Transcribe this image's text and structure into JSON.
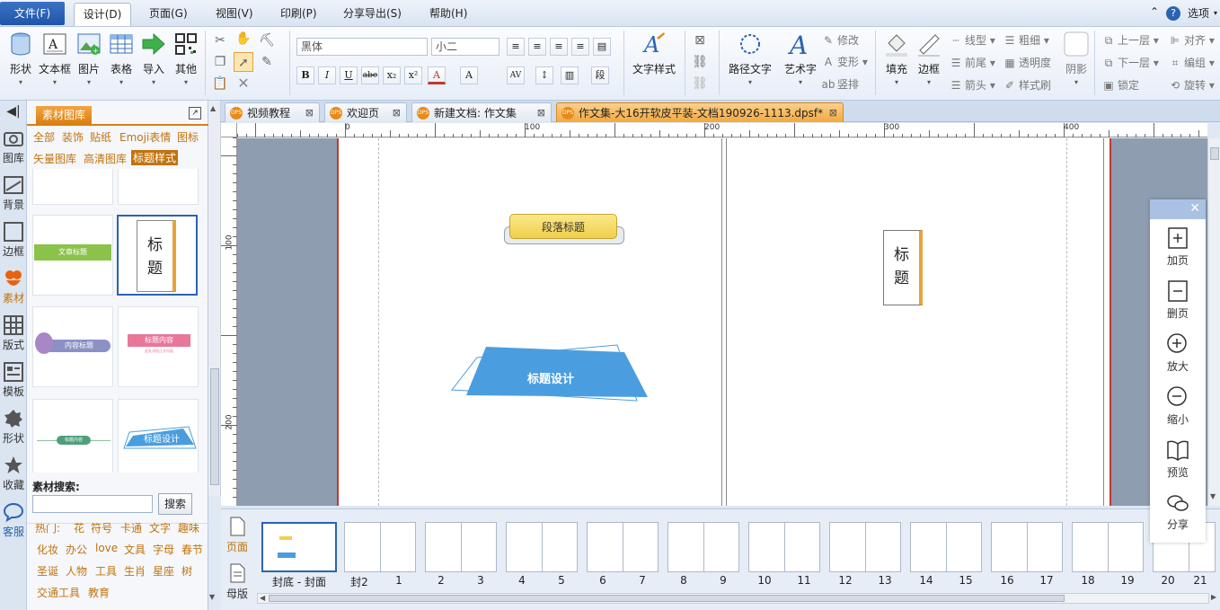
{
  "menu": {
    "file": "文件(F)",
    "items": [
      "设计(D)",
      "页面(G)",
      "视图(V)",
      "印刷(P)",
      "分享导出(S)",
      "帮助(H)"
    ],
    "options": "选项"
  },
  "ribbon": {
    "insert": [
      "形状",
      "文本框",
      "图片",
      "表格",
      "导入",
      "其他"
    ],
    "font_name": "黑体",
    "font_size": "小二",
    "format": [
      "B",
      "I",
      "U",
      "abe",
      "x₂",
      "x²"
    ],
    "text_style": "文字样式",
    "path_text": "路径文字",
    "art_text": "艺术字",
    "art_edit": [
      "修改",
      "变形",
      "竖排"
    ],
    "fill": "填充",
    "border": "边框",
    "line": [
      "线型",
      "前尾",
      "箭头"
    ],
    "thick": [
      "粗细",
      "透明度",
      "样式刷"
    ],
    "shadow": "阴影",
    "layer": [
      "上一层",
      "下一层",
      "锁定"
    ],
    "arrange": [
      "对齐",
      "编组",
      "旋转"
    ],
    "para_btn": "段"
  },
  "rail": [
    "图库",
    "背景",
    "边框",
    "素材",
    "版式",
    "模板",
    "形状",
    "收藏",
    "客服"
  ],
  "panel": {
    "title": "素材图库",
    "cats_row1": [
      "全部",
      "装饰",
      "贴纸",
      "Emoji表情",
      "图标"
    ],
    "cats_row2": [
      "矢量图库",
      "高清图库",
      "标题样式"
    ],
    "thumbs": {
      "article": "文章标题",
      "biaoti": [
        "标",
        "题"
      ],
      "content_title": "内容标题",
      "title_content": "标题内容",
      "title_content_sub": "此处添加正文内容",
      "content_tag": "标题内容",
      "design": "标题设计"
    },
    "search_label": "素材搜索:",
    "search_button": "搜索",
    "hot_label": "热门:",
    "hot_tags": [
      "花",
      "符号",
      "卡通",
      "文字",
      "趣味",
      "化妆",
      "办公",
      "love",
      "文具",
      "字母",
      "春节",
      "圣诞",
      "人物",
      "工具",
      "生肖",
      "星座",
      "树",
      "交通工具",
      "教育"
    ]
  },
  "tabs": [
    {
      "label": "视频教程"
    },
    {
      "label": "欢迎页"
    },
    {
      "label": "新建文档: 作文集"
    },
    {
      "label": "作文集-大16开软皮平装-文档190926-1113.dpsf*"
    }
  ],
  "tab_icon": "DPS",
  "ruler_top": [
    "0",
    "100",
    "200",
    "300",
    "400"
  ],
  "ruler_left": [
    "100",
    "200"
  ],
  "canvas": {
    "para_title": "段落标题",
    "design_title": "标题设计",
    "vertical_title": [
      "标",
      "题"
    ]
  },
  "strip": {
    "page_btn": "页面",
    "master_btn": "母版",
    "labels": [
      "封底 - 封面",
      "封2",
      "1",
      "2",
      "3",
      "4",
      "5",
      "6",
      "7",
      "8",
      "9",
      "10",
      "11",
      "12",
      "13",
      "14",
      "15",
      "16",
      "17",
      "18",
      "19",
      "20",
      "21"
    ]
  },
  "float_panel": [
    "加页",
    "删页",
    "放大",
    "缩小",
    "预览",
    "分享"
  ],
  "colors": {
    "accent": "#2b63b3",
    "orange": "#c2730d",
    "blue_shape": "#4a9ee0",
    "yellow": "#f7df6e"
  }
}
